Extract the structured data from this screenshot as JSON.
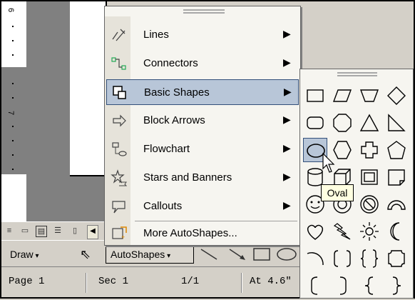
{
  "ruler": {
    "numbers": [
      "6",
      "7"
    ]
  },
  "autoshapes_menu": {
    "items": [
      {
        "label": "Lines",
        "icon": "lines-icon",
        "has_submenu": true,
        "selected": false
      },
      {
        "label": "Connectors",
        "icon": "connectors-icon",
        "has_submenu": true,
        "selected": false
      },
      {
        "label": "Basic Shapes",
        "icon": "basic-shapes-icon",
        "has_submenu": true,
        "selected": true
      },
      {
        "label": "Block Arrows",
        "icon": "block-arrows-icon",
        "has_submenu": true,
        "selected": false
      },
      {
        "label": "Flowchart",
        "icon": "flowchart-icon",
        "has_submenu": true,
        "selected": false
      },
      {
        "label": "Stars and Banners",
        "icon": "stars-banners-icon",
        "has_submenu": true,
        "selected": false
      },
      {
        "label": "Callouts",
        "icon": "callouts-icon",
        "has_submenu": true,
        "selected": false
      },
      {
        "label": "More AutoShapes...",
        "icon": "more-autoshapes-icon",
        "has_submenu": false,
        "selected": false
      }
    ]
  },
  "basic_shapes_submenu": {
    "highlighted": "oval",
    "tooltip": "Oval",
    "shapes": [
      "rectangle",
      "parallelogram",
      "trapezoid",
      "diamond",
      "rounded-rectangle",
      "octagon",
      "triangle",
      "right-triangle",
      "oval",
      "hexagon",
      "cross",
      "pentagon",
      "can",
      "cube",
      "bevel",
      "folded-corner",
      "smiley-face",
      "donut",
      "no-symbol",
      "block-arc",
      "heart",
      "lightning-bolt",
      "sun",
      "moon",
      "arc",
      "double-bracket",
      "double-brace",
      "plaque",
      "left-bracket",
      "right-bracket",
      "left-brace",
      "right-brace"
    ]
  },
  "drawing_toolbar": {
    "draw_label": "Draw",
    "autoshapes_label": "AutoShapes"
  },
  "status_bar": {
    "page": "Page 1",
    "sec": "Sec 1",
    "pages": "1/1",
    "at": "At 4.6\""
  },
  "colors": {
    "menu_highlight": "#b8c6d8",
    "highlight_border": "#33507a",
    "tooltip_bg": "#ffffe1"
  }
}
